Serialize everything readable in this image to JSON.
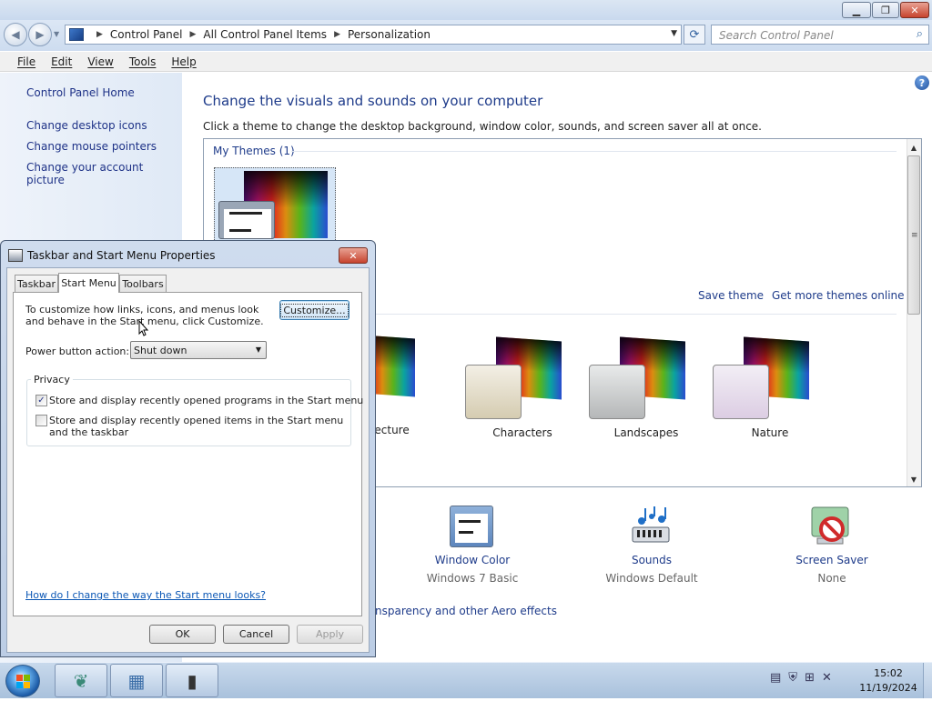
{
  "window": {
    "caption_buttons": {
      "minimize": "▁",
      "maximize": "❐",
      "close": "✕"
    }
  },
  "navigation": {
    "back_glyph": "◀",
    "forward_glyph": "▶",
    "breadcrumb": [
      "Control Panel",
      "All Control Panel Items",
      "Personalization"
    ],
    "search_placeholder": "Search Control Panel"
  },
  "menubar": [
    "File",
    "Edit",
    "View",
    "Tools",
    "Help"
  ],
  "left_pane": {
    "home": "Control Panel Home",
    "links": [
      "Change desktop icons",
      "Change mouse pointers",
      "Change your account picture"
    ]
  },
  "main": {
    "title": "Change the visuals and sounds on your computer",
    "subtitle": "Click a theme to change the desktop background, window color, sounds, and screen saver all at once.",
    "my_themes_label": "My Themes (1)",
    "save_theme": "Save theme",
    "get_more_themes": "Get more themes online",
    "themes": [
      "Architecture",
      "Characters",
      "Landscapes",
      "Nature"
    ],
    "bottom": [
      {
        "label": "Window Color",
        "value": "Windows 7 Basic"
      },
      {
        "label": "Sounds",
        "value": "Windows Default"
      },
      {
        "label": "Screen Saver",
        "value": "None"
      }
    ],
    "aero_link": "nsparency and other Aero effects",
    "help_glyph": "?"
  },
  "dialog": {
    "title": "Taskbar and Start Menu Properties",
    "tabs": [
      "Taskbar",
      "Start Menu",
      "Toolbars"
    ],
    "active_tab": "Start Menu",
    "description": "To customize how links, icons, and menus look and behave in the Start menu, click Customize.",
    "customize_button": "Customize...",
    "power_button_label": "Power button action:",
    "power_button_value": "Shut down",
    "privacy_label": "Privacy",
    "checkboxes": [
      {
        "label": "Store and display recently opened programs in the Start menu",
        "checked": true,
        "mark": "✓"
      },
      {
        "label": "Store and display recently opened items in the Start menu and the taskbar",
        "checked": false,
        "mark": ""
      }
    ],
    "help_link": "How do I change the way the Start menu looks?",
    "ok": "OK",
    "cancel": "Cancel",
    "apply": "Apply"
  },
  "taskbar": {
    "time": "15:02",
    "date": "11/19/2024"
  }
}
